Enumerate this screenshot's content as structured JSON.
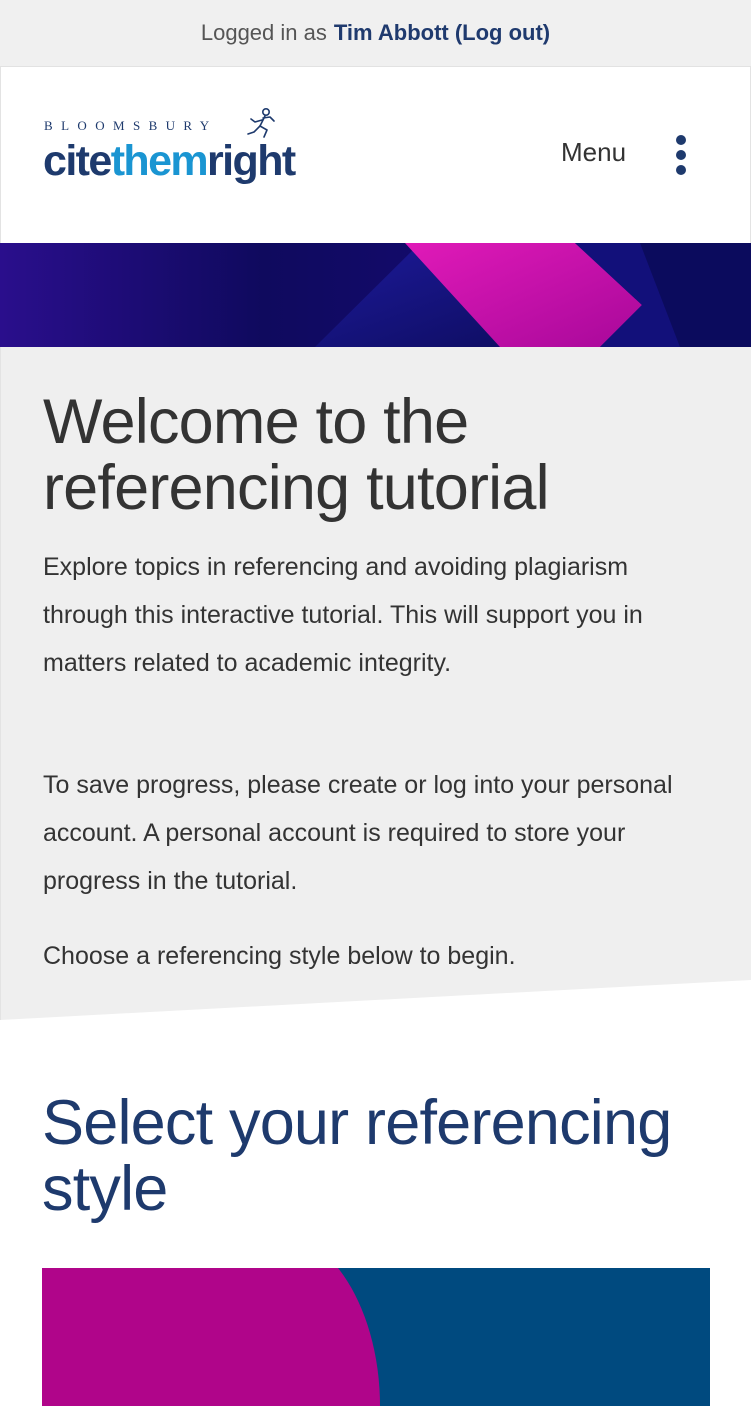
{
  "topbar": {
    "prefix": "Logged in as",
    "user_link": "Tim Abbott (Log out)"
  },
  "logo": {
    "publisher": "BLOOMSBURY",
    "word_cite": "cite",
    "word_them": "them",
    "word_right": "right"
  },
  "header": {
    "menu_label": "Menu",
    "more_icon": "vertical-dots-icon"
  },
  "intro": {
    "title": "Welcome to the referencing tutorial",
    "paragraph_1": "Explore topics in referencing and avoiding plagiarism through this interactive tutorial. This will support you in matters related to academic integrity.",
    "paragraph_2": "To save progress, please create or log into your personal account. A personal account is required to store your progress in the tutorial.",
    "paragraph_3": "Choose a referencing style below to begin."
  },
  "select": {
    "title": "Select your referencing style"
  },
  "colors": {
    "brand_navy": "#1e3a6d",
    "brand_blue": "#1a95d2",
    "magenta": "#b0058a",
    "card_blue": "#004a7f",
    "intro_bg": "#efefef",
    "topbar_bg": "#f0f0f0"
  }
}
